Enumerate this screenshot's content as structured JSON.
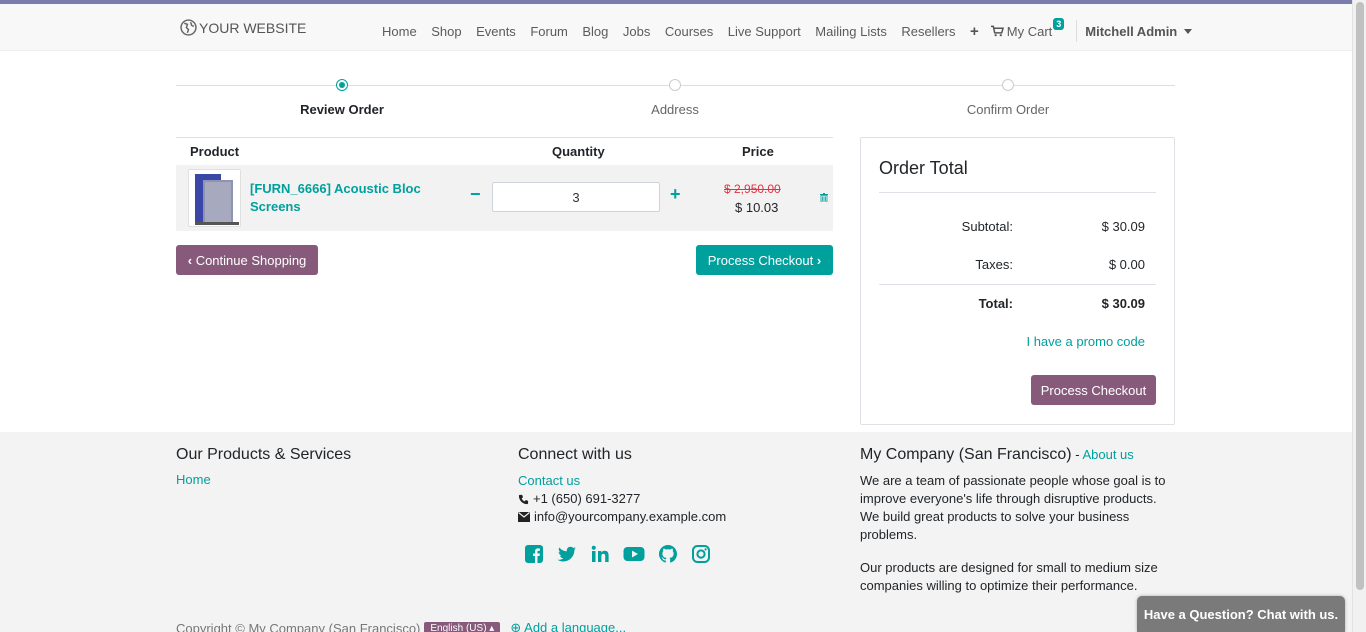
{
  "header": {
    "logo_text": "YOUR WEBSITE",
    "nav": [
      "Home",
      "Shop",
      "Events",
      "Forum",
      "Blog",
      "Jobs",
      "Courses",
      "Live Support",
      "Mailing Lists",
      "Resellers"
    ],
    "plus": "+",
    "cart_label": "My Cart",
    "cart_count": "3",
    "user": "Mitchell Admin"
  },
  "steps": [
    {
      "label": "Review Order",
      "active": true
    },
    {
      "label": "Address",
      "active": false
    },
    {
      "label": "Confirm Order",
      "active": false
    }
  ],
  "cart_table": {
    "headers": {
      "product": "Product",
      "quantity": "Quantity",
      "price": "Price"
    },
    "rows": [
      {
        "name": "[FURN_6666] Acoustic Bloc Screens",
        "quantity": "3",
        "price_old": "$ 2,950.00",
        "price_new": "$ 10.03"
      }
    ]
  },
  "buttons": {
    "continue": "Continue Shopping",
    "checkout": "Process Checkout"
  },
  "order_total": {
    "title": "Order Total",
    "subtotal_label": "Subtotal:",
    "subtotal": "$ 30.09",
    "taxes_label": "Taxes:",
    "taxes": "$ 0.00",
    "total_label": "Total:",
    "total": "$ 30.09",
    "promo": "I have a promo code",
    "checkout": "Process Checkout"
  },
  "footer": {
    "products_title": "Our Products & Services",
    "products_link": "Home",
    "connect_title": "Connect with us",
    "contact_link": "Contact us",
    "phone": "+1 (650) 691-3277",
    "email": "info@yourcompany.example.com",
    "company_title": "My Company (San Francisco)",
    "about_sep": " - ",
    "about_link": "About us",
    "about_p1": "We are a team of passionate people whose goal is to improve everyone's life through disruptive products. We build great products to solve your business problems.",
    "about_p2": "Our products are designed for small to medium size companies willing to optimize their performance.",
    "copyright": "Copyright © My Company (San Francisco)",
    "language": "English (US)",
    "add_language": "Add a language..."
  },
  "chat": "Have a Question? Chat with us.",
  "colors": {
    "primary": "#00a09d",
    "secondary": "#875a7b",
    "accent_bar": "#7c7bad"
  }
}
